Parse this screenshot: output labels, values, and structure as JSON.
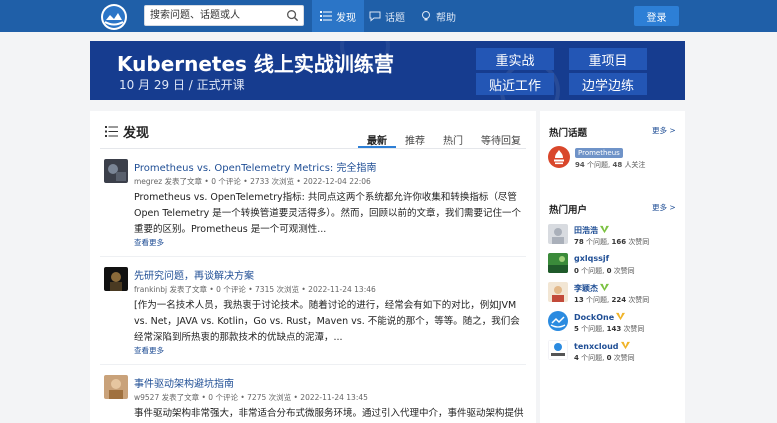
{
  "header": {
    "search_placeholder": "搜索问题、话题或人",
    "nav": [
      {
        "label": "发现",
        "icon": "list-icon",
        "active": true
      },
      {
        "label": "话题",
        "icon": "chat-icon",
        "active": false
      },
      {
        "label": "帮助",
        "icon": "bulb-icon",
        "active": false
      }
    ],
    "login_label": "登录",
    "colors": {
      "topbar": "#1f5fa8",
      "active_nav": "#2b75c7",
      "login": "#2d7fd6"
    }
  },
  "banner": {
    "title": "Kubernetes 线上实战训练营",
    "subtitle": "10 月 29 日 / 正式开课",
    "tags": [
      "重实战",
      "重项目",
      "贴近工作",
      "边学边练"
    ]
  },
  "main": {
    "title": "发现",
    "tabs": [
      "最新",
      "推荐",
      "热门",
      "等待回复"
    ],
    "more_label": "查看更多",
    "items": [
      {
        "title": "Prometheus vs. OpenTelemetry Metrics: 完全指南",
        "meta": "megrez 发表了文章 • 0 个评论 • 2733 次浏览 • 2022-12-04 22:06",
        "body": "Prometheus vs. OpenTelemetry指标: 共同点这两个系统都允许你收集和转换指标（尽管Open Telemetry 是一个转换管道要灵活得多）。然而，回顾以前的文章，我们需要记住一个重要的区别。Prometheus 是一个可观测性..."
      },
      {
        "title": "先研究问题，再谈解决方案",
        "meta": "frankinbj 发表了文章 • 0 个评论 • 7315 次浏览 • 2022-11-24 13:46",
        "body": "[作为一名技术人员，我热衷于讨论技术。随着讨论的进行，经常会有如下的对比，例如JVM vs. Net，JAVA vs. Kotlin，Go vs. Rust，Maven vs. 不能说的那个，等等。随之，我们会经常深陷到所热衷的那款技术的优缺点的泥潭，..."
      },
      {
        "title": "事件驱动架构避坑指南",
        "meta": "w9527 发表了文章 • 0 个评论 • 7275 次浏览 • 2022-11-24 13:45",
        "body": "事件驱动架构非常强大，非常适合分布式微服务环境。通过引入代理中介，事件驱动架构提供了更好的"
      }
    ]
  },
  "sidebar": {
    "hot_topics_title": "热门话题",
    "more_label": "更多 >",
    "topic": {
      "name": "Prometheus",
      "articles": "94",
      "articles_label": "个问题,",
      "followers": "48",
      "followers_label": "人关注"
    },
    "hot_users_title": "热门用户",
    "users": [
      {
        "name": "田浩浩",
        "verified": true,
        "questions": "78",
        "likes": "166"
      },
      {
        "name": "gxlqssjf",
        "verified": false,
        "questions": "0",
        "likes": "0"
      },
      {
        "name": "李颖杰",
        "verified": true,
        "questions": "13",
        "likes": "224"
      },
      {
        "name": "DockOne",
        "verified": true,
        "questions": "5",
        "likes": "143"
      },
      {
        "name": "tenxcloud",
        "verified": true,
        "questions": "4",
        "likes": "0"
      }
    ],
    "question_unit": "个问题,",
    "like_unit": "次赞同"
  }
}
